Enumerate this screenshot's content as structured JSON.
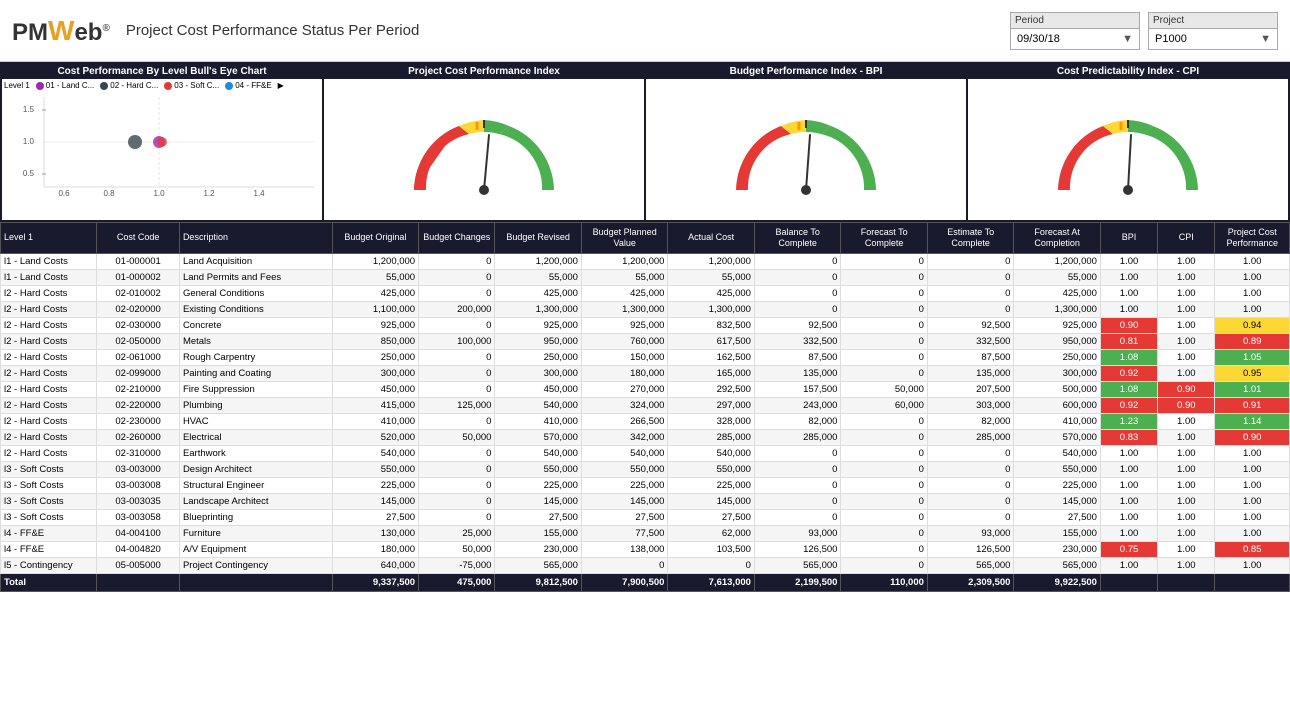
{
  "header": {
    "logo": "PMWeb",
    "title": "Project Cost Performance Status Per Period",
    "period_label": "Period",
    "period_value": "09/30/18",
    "project_label": "Project",
    "project_value": "P1000"
  },
  "charts": {
    "bull_eye": {
      "title": "Cost Performance By Level Bull's Eye Chart",
      "legend": [
        {
          "label": "Level 1",
          "color": "transparent"
        },
        {
          "label": "01 - Land C...",
          "color": "#9c27b0"
        },
        {
          "label": "02 - Hard C...",
          "color": "#37474f"
        },
        {
          "label": "03 - Soft C...",
          "color": "#e53935"
        },
        {
          "label": "04 - FF&E",
          "color": "#1e88e5"
        }
      ]
    },
    "project_cost_index": {
      "title": "Project Cost Performance Index"
    },
    "bpi": {
      "title": "Budget Performance Index - BPI"
    },
    "cpi": {
      "title": "Cost Predictability Index - CPI"
    }
  },
  "table": {
    "columns": [
      "Level 1",
      "Cost Code",
      "Description",
      "Budget Original",
      "Budget Changes",
      "Budget Revised",
      "Budget Planned Value",
      "Actual Cost",
      "Balance To Complete",
      "Forecast To Complete",
      "Estimate To Complete",
      "Forecast At Completion",
      "BPI",
      "CPI",
      "Project Cost Performance"
    ],
    "rows": [
      [
        "l1 - Land Costs",
        "01-000001",
        "Land Acquisition",
        "1,200,000",
        "0",
        "1,200,000",
        "1,200,000",
        "1,200,000",
        "0",
        "0",
        "0",
        "1,200,000",
        "1.00",
        "1.00",
        "1.00",
        "neutral",
        "neutral",
        "neutral"
      ],
      [
        "l1 - Land Costs",
        "01-000002",
        "Land Permits and Fees",
        "55,000",
        "0",
        "55,000",
        "55,000",
        "55,000",
        "0",
        "0",
        "0",
        "55,000",
        "1.00",
        "1.00",
        "1.00",
        "neutral",
        "neutral",
        "neutral"
      ],
      [
        "l2 - Hard Costs",
        "02-010002",
        "General Conditions",
        "425,000",
        "0",
        "425,000",
        "425,000",
        "425,000",
        "0",
        "0",
        "0",
        "425,000",
        "1.00",
        "1.00",
        "1.00",
        "neutral",
        "neutral",
        "neutral"
      ],
      [
        "l2 - Hard Costs",
        "02-020000",
        "Existing Conditions",
        "1,100,000",
        "200,000",
        "1,300,000",
        "1,300,000",
        "1,300,000",
        "0",
        "0",
        "0",
        "1,300,000",
        "1.00",
        "1.00",
        "1.00",
        "neutral",
        "neutral",
        "neutral"
      ],
      [
        "l2 - Hard Costs",
        "02-030000",
        "Concrete",
        "925,000",
        "0",
        "925,000",
        "925,000",
        "832,500",
        "92,500",
        "0",
        "92,500",
        "925,000",
        "0.90",
        "1.00",
        "0.94",
        "red",
        "neutral",
        "yellow"
      ],
      [
        "l2 - Hard Costs",
        "02-050000",
        "Metals",
        "850,000",
        "100,000",
        "950,000",
        "760,000",
        "617,500",
        "332,500",
        "0",
        "332,500",
        "950,000",
        "0.81",
        "1.00",
        "0.89",
        "red",
        "neutral",
        "red"
      ],
      [
        "l2 - Hard Costs",
        "02-061000",
        "Rough Carpentry",
        "250,000",
        "0",
        "250,000",
        "150,000",
        "162,500",
        "87,500",
        "0",
        "87,500",
        "250,000",
        "1.08",
        "1.00",
        "1.05",
        "green",
        "neutral",
        "green"
      ],
      [
        "l2 - Hard Costs",
        "02-099000",
        "Painting and Coating",
        "300,000",
        "0",
        "300,000",
        "180,000",
        "165,000",
        "135,000",
        "0",
        "135,000",
        "300,000",
        "0.92",
        "1.00",
        "0.95",
        "red",
        "neutral",
        "yellow"
      ],
      [
        "l2 - Hard Costs",
        "02-210000",
        "Fire Suppression",
        "450,000",
        "0",
        "450,000",
        "270,000",
        "292,500",
        "157,500",
        "50,000",
        "207,500",
        "500,000",
        "1.08",
        "0.90",
        "1.01",
        "green",
        "red",
        "green"
      ],
      [
        "l2 - Hard Costs",
        "02-220000",
        "Plumbing",
        "415,000",
        "125,000",
        "540,000",
        "324,000",
        "297,000",
        "243,000",
        "60,000",
        "303,000",
        "600,000",
        "0.92",
        "0.90",
        "0.91",
        "red",
        "red",
        "red"
      ],
      [
        "l2 - Hard Costs",
        "02-230000",
        "HVAC",
        "410,000",
        "0",
        "410,000",
        "266,500",
        "328,000",
        "82,000",
        "0",
        "82,000",
        "410,000",
        "1.23",
        "1.00",
        "1.14",
        "green",
        "neutral",
        "green"
      ],
      [
        "l2 - Hard Costs",
        "02-260000",
        "Electrical",
        "520,000",
        "50,000",
        "570,000",
        "342,000",
        "285,000",
        "285,000",
        "0",
        "285,000",
        "570,000",
        "0.83",
        "1.00",
        "0.90",
        "red",
        "neutral",
        "red"
      ],
      [
        "l2 - Hard Costs",
        "02-310000",
        "Earthwork",
        "540,000",
        "0",
        "540,000",
        "540,000",
        "540,000",
        "0",
        "0",
        "0",
        "540,000",
        "1.00",
        "1.00",
        "1.00",
        "neutral",
        "neutral",
        "neutral"
      ],
      [
        "l3 - Soft Costs",
        "03-003000",
        "Design Architect",
        "550,000",
        "0",
        "550,000",
        "550,000",
        "550,000",
        "0",
        "0",
        "0",
        "550,000",
        "1.00",
        "1.00",
        "1.00",
        "neutral",
        "neutral",
        "neutral"
      ],
      [
        "l3 - Soft Costs",
        "03-003008",
        "Structural Engineer",
        "225,000",
        "0",
        "225,000",
        "225,000",
        "225,000",
        "0",
        "0",
        "0",
        "225,000",
        "1.00",
        "1.00",
        "1.00",
        "neutral",
        "neutral",
        "neutral"
      ],
      [
        "l3 - Soft Costs",
        "03-003035",
        "Landscape Architect",
        "145,000",
        "0",
        "145,000",
        "145,000",
        "145,000",
        "0",
        "0",
        "0",
        "145,000",
        "1.00",
        "1.00",
        "1.00",
        "neutral",
        "neutral",
        "neutral"
      ],
      [
        "l3 - Soft Costs",
        "03-003058",
        "Blueprinting",
        "27,500",
        "0",
        "27,500",
        "27,500",
        "27,500",
        "0",
        "0",
        "0",
        "27,500",
        "1.00",
        "1.00",
        "1.00",
        "neutral",
        "neutral",
        "neutral"
      ],
      [
        "l4 - FF&E",
        "04-004100",
        "Furniture",
        "130,000",
        "25,000",
        "155,000",
        "77,500",
        "62,000",
        "93,000",
        "0",
        "93,000",
        "155,000",
        "1.00",
        "1.00",
        "1.00",
        "neutral",
        "neutral",
        "neutral"
      ],
      [
        "l4 - FF&E",
        "04-004820",
        "A/V Equipment",
        "180,000",
        "50,000",
        "230,000",
        "138,000",
        "103,500",
        "126,500",
        "0",
        "126,500",
        "230,000",
        "0.75",
        "1.00",
        "0.85",
        "red",
        "neutral",
        "red"
      ],
      [
        "l5 - Contingency",
        "05-005000",
        "Project Contingency",
        "640,000",
        "-75,000",
        "565,000",
        "0",
        "0",
        "565,000",
        "0",
        "565,000",
        "565,000",
        "1.00",
        "1.00",
        "1.00",
        "neutral",
        "neutral",
        "neutral"
      ]
    ],
    "totals": [
      "Total",
      "",
      "",
      "9,337,500",
      "475,000",
      "9,812,500",
      "7,900,500",
      "7,613,000",
      "2,199,500",
      "110,000",
      "2,309,500",
      "9,922,500",
      "",
      "",
      ""
    ]
  }
}
